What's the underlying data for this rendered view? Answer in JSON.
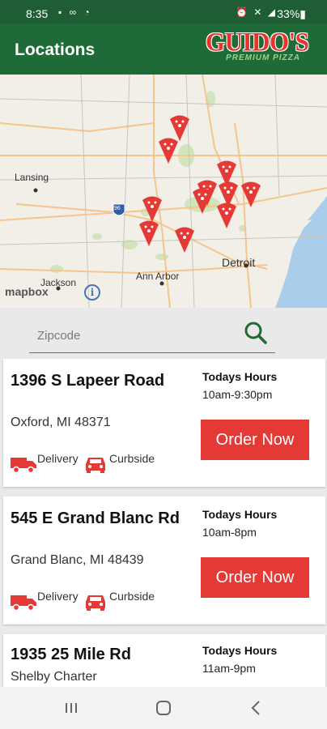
{
  "status_bar": {
    "time": "8:35",
    "left_icons": "▪ ∞ ◔",
    "right_icons": "⏰ ✕ ◢",
    "battery": "33%▮"
  },
  "app_bar": {
    "title": "Locations",
    "logo_main": "GUIDO'S",
    "logo_sub": "PREMIUM PIZZA"
  },
  "map": {
    "labels": {
      "lansing": "Lansing",
      "detroit": "Detroit",
      "ann_arbor": "Ann Arbor",
      "jackson": "Jackson",
      "highway": "96"
    },
    "attribution": "mapbox",
    "info": "i"
  },
  "search": {
    "placeholder": "Zipcode"
  },
  "common": {
    "hours_label": "Todays Hours",
    "order_label": "Order Now",
    "delivery_label": "Delivery",
    "curbside_label": "Curbside"
  },
  "locations": [
    {
      "address": "1396 S Lapeer Road",
      "city": "Oxford, MI 48371",
      "hours": "10am-9:30pm"
    },
    {
      "address": "545 E Grand Blanc Rd",
      "city": "Grand Blanc, MI 48439",
      "hours": "10am-8pm"
    },
    {
      "address": "1935 25 Mile Rd",
      "city": "Shelby Charter",
      "hours": "11am-9pm"
    }
  ],
  "colors": {
    "brand_green": "#1f6b37",
    "status_green": "#1f5d34",
    "accent_red": "#e53935",
    "search_green": "#1f6b37"
  }
}
